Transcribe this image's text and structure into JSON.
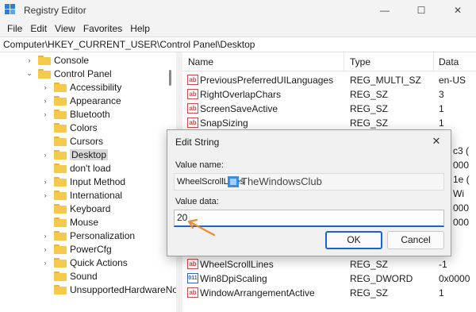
{
  "window": {
    "title": "Registry Editor",
    "controls": [
      "—",
      "☐",
      "✕"
    ]
  },
  "menu": [
    "File",
    "Edit",
    "View",
    "Favorites",
    "Help"
  ],
  "address": "Computer\\HKEY_CURRENT_USER\\Control Panel\\Desktop",
  "tree": {
    "items": [
      {
        "label": "Console",
        "chevron": "›"
      },
      {
        "label": "Control Panel",
        "chevron": "⌄"
      },
      {
        "label": "Accessibility",
        "chevron": "›"
      },
      {
        "label": "Appearance",
        "chevron": "›"
      },
      {
        "label": "Bluetooth",
        "chevron": "›"
      },
      {
        "label": "Colors",
        "chevron": ""
      },
      {
        "label": "Cursors",
        "chevron": ""
      },
      {
        "label": "Desktop",
        "chevron": "›"
      },
      {
        "label": "don't load",
        "chevron": ""
      },
      {
        "label": "Input Method",
        "chevron": "›"
      },
      {
        "label": "International",
        "chevron": "›"
      },
      {
        "label": "Keyboard",
        "chevron": ""
      },
      {
        "label": "Mouse",
        "chevron": ""
      },
      {
        "label": "Personalization",
        "chevron": "›"
      },
      {
        "label": "PowerCfg",
        "chevron": "›"
      },
      {
        "label": "Quick Actions",
        "chevron": "›"
      },
      {
        "label": "Sound",
        "chevron": ""
      },
      {
        "label": "UnsupportedHardwareNo",
        "chevron": ""
      }
    ]
  },
  "values": {
    "columns": [
      "Name",
      "Type",
      "Data"
    ],
    "rows_top": [
      {
        "name": "PreviousPreferredUILanguages",
        "type": "REG_MULTI_SZ",
        "data": "en-US",
        "icon": "ab"
      },
      {
        "name": "RightOverlapChars",
        "type": "REG_SZ",
        "data": "3",
        "icon": "ab"
      },
      {
        "name": "ScreenSaveActive",
        "type": "REG_SZ",
        "data": "1",
        "icon": "ab"
      },
      {
        "name": "SnapSizing",
        "type": "REG_SZ",
        "data": "1",
        "icon": "ab"
      }
    ],
    "right_fragments": [
      "c3 (",
      "000",
      "1e (",
      "Wi",
      "000",
      "000"
    ],
    "rows_bottom": [
      {
        "name": "WheelScrollLines",
        "type": "REG_SZ",
        "data": "-1",
        "icon": "ab"
      },
      {
        "name": "Win8DpiScaling",
        "type": "REG_DWORD",
        "data": "0x0000",
        "icon": "011"
      },
      {
        "name": "WindowArrangementActive",
        "type": "REG_SZ",
        "data": "1",
        "icon": "ab"
      }
    ]
  },
  "dialog": {
    "title": "Edit String",
    "value_name_label": "Value name:",
    "value_name": "WheelScrollLines",
    "value_data_label": "Value data:",
    "value_data": "20",
    "ok": "OK",
    "cancel": "Cancel",
    "close": "✕"
  },
  "watermark": "TheWindowsClub",
  "colors": {
    "accent": "#1b65c9",
    "arrow": "#f08a2c",
    "folder": "#f5c94c"
  }
}
